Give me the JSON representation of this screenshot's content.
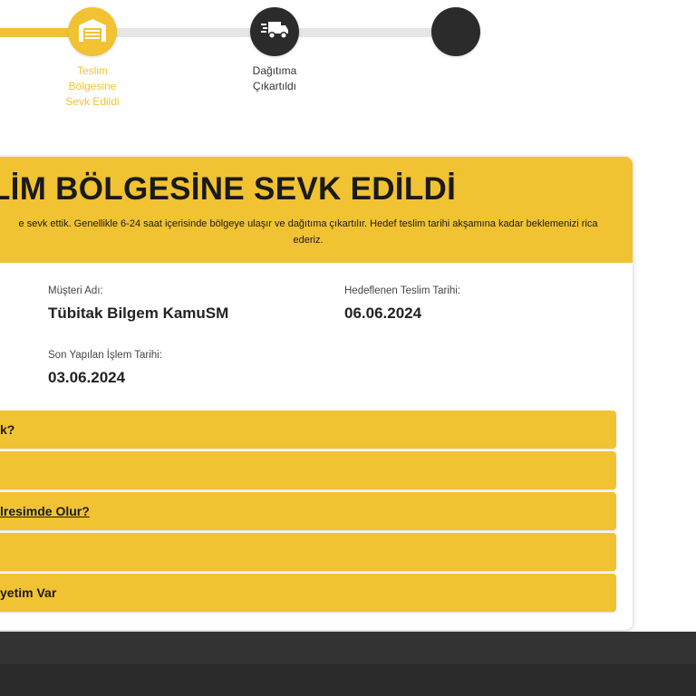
{
  "tracker": {
    "steps": [
      {
        "label": "Teslim Bölgesine Sevk Edildi",
        "state": "active",
        "icon": "warehouse-icon"
      },
      {
        "label": "Dağıtıma Çıkartıldı",
        "state": "pending",
        "icon": "delivery-truck-icon"
      },
      {
        "label": "",
        "state": "pending",
        "icon": "delivered-icon"
      }
    ],
    "step1_lines": [
      "Teslim",
      "Bölgesine",
      "Sevk Edildi"
    ],
    "step2_lines": [
      "Dağıtıma",
      "Çıkartıldı"
    ],
    "progress": 0.2
  },
  "card": {
    "title": "LİM BÖLGESİNE SEVK EDİLDİ",
    "desc_line1": "e sevk ettik. Genellikle 6-24 saat içerisinde bölgeye ulaşır ve dağıtıma çıkartılır. Hedef teslim tarihi akşamına kadar beklemenizi rica",
    "desc_line2": "ederiz.",
    "customer_label": "Müşteri Adı:",
    "customer_value": "Tübitak Bilgem KamuSM",
    "target_label": "Hedeflenen Teslim Tarihi:",
    "target_value": "06.06.2024",
    "last_action_label": "Son Yapılan İşlem Tarihi:",
    "last_action_value": "03.06.2024"
  },
  "faq": [
    {
      "label": "k?"
    },
    {
      "label": ""
    },
    {
      "label": "lresimde Olur?"
    },
    {
      "label": ""
    },
    {
      "label": "yetim Var"
    }
  ],
  "colors": {
    "accent": "#F1C232",
    "dark": "#2b2b2b",
    "footer": "#2a2a2a"
  }
}
